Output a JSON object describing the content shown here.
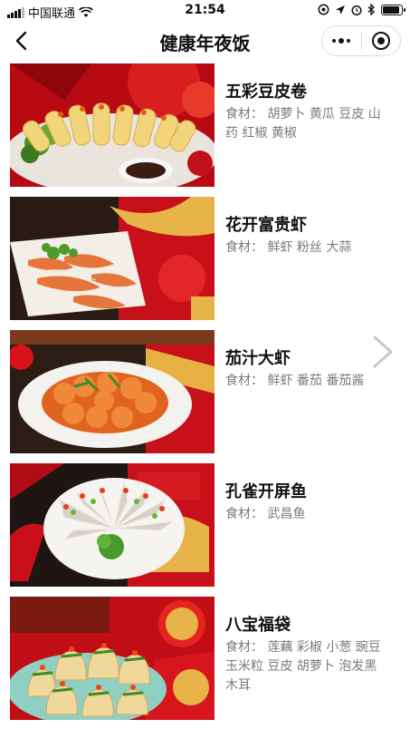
{
  "status_bar": {
    "carrier": "中国联通",
    "time": "21:54",
    "battery_level_percent": 90
  },
  "nav": {
    "title": "健康年夜饭"
  },
  "dishes": [
    {
      "name": "五彩豆皮卷",
      "ingredients": "食材： 胡萝卜  黄瓜  豆皮  山药  红椒  黄椒"
    },
    {
      "name": "花开富贵虾",
      "ingredients": "食材： 鲜虾  粉丝  大蒜"
    },
    {
      "name": "茄汁大虾",
      "ingredients": "食材： 鲜虾  番茄  番茄酱"
    },
    {
      "name": "孔雀开屏鱼",
      "ingredients": "食材： 武昌鱼"
    },
    {
      "name": "八宝福袋",
      "ingredients": "食材： 莲藕  彩椒  小葱  豌豆  玉米粒  豆皮  胡萝卜  泡发黑木耳"
    }
  ],
  "colors": {
    "festive_red": "#c8101a",
    "gold": "#e9b949",
    "muted_text": "#7a7a7a"
  },
  "icons": [
    "signal-icon",
    "wifi-icon",
    "alarm-icon",
    "location-icon",
    "bluetooth-icon",
    "battery-icon",
    "back-arrow-icon",
    "more-dots-icon",
    "target-icon",
    "chevron-right-icon"
  ]
}
